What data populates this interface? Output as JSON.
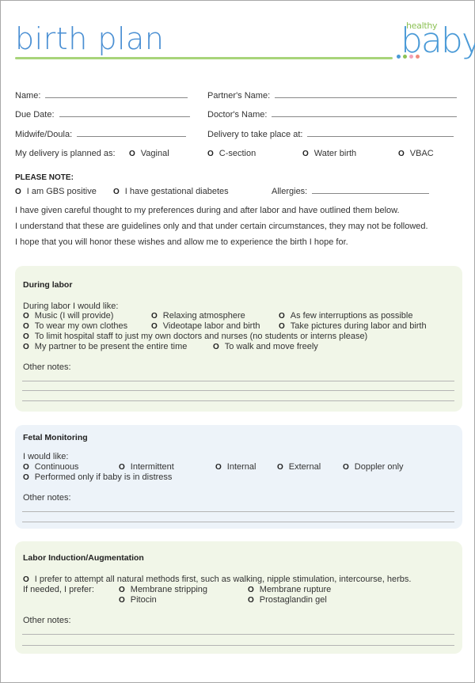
{
  "header": {
    "title": "birth plan",
    "logo_top": "healthy",
    "logo_main": "baby",
    "accent_colors": {
      "title_blue": "#4a8fd3",
      "rule_green": "#a8d47a",
      "logo_green": "#8dc155",
      "dots": [
        "#4a9ad7",
        "#8dc155",
        "#f2a1b8",
        "#f08a7a"
      ]
    }
  },
  "fields": {
    "name": "Name:",
    "partner_name": "Partner's Name:",
    "due_date": "Due Date:",
    "doctor_name": "Doctor's Name:",
    "midwife": "Midwife/Doula:",
    "delivery_place": "Delivery to take place at:",
    "delivery_planned": "My delivery is planned as:",
    "delivery_options": [
      "Vaginal",
      "C-section",
      "Water birth",
      "VBAC"
    ]
  },
  "please_note": {
    "heading": "PLEASE NOTE:",
    "options": [
      "I am GBS positive",
      "I have gestational diabetes"
    ],
    "allergies": "Allergies:"
  },
  "intro": [
    "I have given careful thought to my preferences during and after labor and have outlined them below.",
    "I understand that these are guidelines only and that under certain circumstances, they may not be followed.",
    "I hope that you will honor these wishes and allow me to experience the birth I hope for."
  ],
  "radio_glyph": "O",
  "sections": {
    "during_labor": {
      "title": "During labor",
      "prompt": "During labor I would like:",
      "options": [
        "Music (I will provide)",
        "Relaxing atmosphere",
        "As few interruptions as possible",
        "To wear my own clothes",
        "Videotape labor and birth",
        "Take pictures during labor and birth",
        "To limit hospital staff to just my own doctors and nurses (no students or interns please)",
        "My partner to be present the entire time",
        "To walk and move freely"
      ],
      "notes_label": "Other notes:",
      "bg": "#f1f6e8"
    },
    "fetal_monitoring": {
      "title": "Fetal Monitoring",
      "prompt": "I would like:",
      "options": [
        "Continuous",
        "Intermittent",
        "Internal",
        "External",
        "Doppler only",
        "Performed only if baby is in distress"
      ],
      "notes_label": "Other notes:",
      "bg": "#edf3f9"
    },
    "induction": {
      "title": "Labor Induction/Augmentation",
      "natural": "I prefer to attempt all natural methods first, such as walking, nipple stimulation, intercourse, herbs.",
      "prompt": "If needed, I prefer:",
      "options": [
        "Membrane stripping",
        "Membrane rupture",
        "Pitocin",
        "Prostaglandin gel"
      ],
      "notes_label": "Other notes:",
      "bg": "#f1f6e8"
    }
  }
}
